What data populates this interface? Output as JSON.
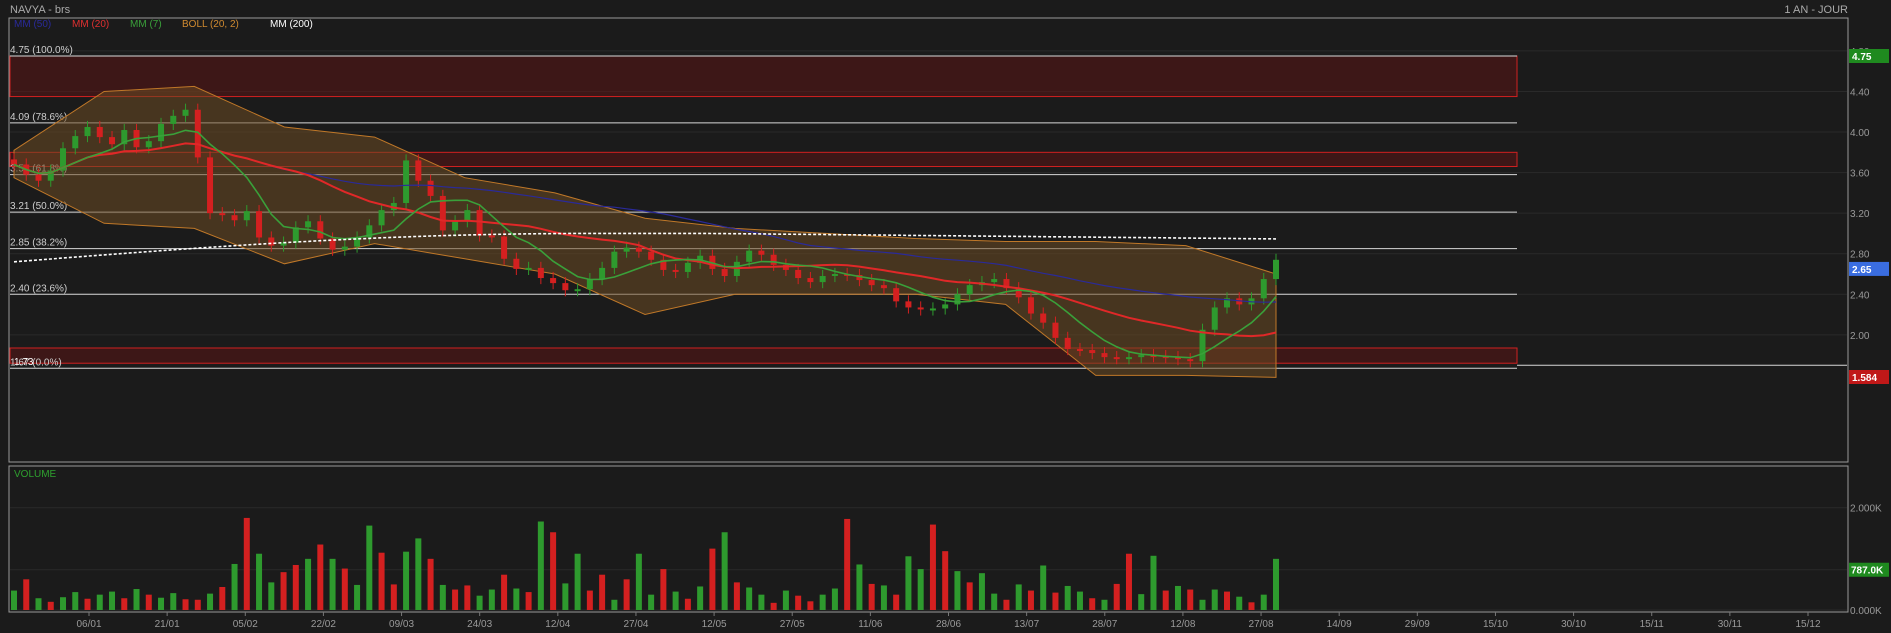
{
  "header": {
    "title": "NAVYA - brs",
    "period": "1 AN - JOUR",
    "legend": [
      {
        "label": "MM (50)",
        "color": "#2a2a9a"
      },
      {
        "label": "MM (20)",
        "color": "#e03030"
      },
      {
        "label": "MM (7)",
        "color": "#3aa03a"
      },
      {
        "label": "BOLL (20, 2)",
        "color": "#d08a30"
      },
      {
        "label": "MM (200)",
        "color": "#ffffff"
      }
    ]
  },
  "colors": {
    "bull": "#2e9a2e",
    "bear": "#d42020",
    "background": "#1b1b1b",
    "grid": "#2a2a2a"
  },
  "chart_data": [
    {
      "type": "candlestick",
      "title": "NAVYA - brs",
      "ylim": [
        1.584,
        4.95
      ],
      "y_ticks": [
        "4.80",
        "4.40",
        "4.00",
        "3.60",
        "3.20",
        "2.80",
        "2.40",
        "2.00"
      ],
      "y_tick_values": [
        4.8,
        4.4,
        4.0,
        3.6,
        3.2,
        2.8,
        2.4,
        2.0
      ],
      "x_ticks": [
        "06/01",
        "21/01",
        "05/02",
        "22/02",
        "09/03",
        "24/03",
        "12/04",
        "27/04",
        "12/05",
        "27/05",
        "11/06",
        "28/06",
        "13/07",
        "28/07",
        "12/08",
        "27/08",
        "14/09",
        "29/09",
        "15/10",
        "30/10",
        "15/11",
        "30/11",
        "15/12"
      ],
      "price_tags": [
        {
          "label": "4.75",
          "value": 4.75,
          "color": "#1f8a1f"
        },
        {
          "label": "2.65",
          "value": 2.65,
          "color": "#3a6de0"
        },
        {
          "label": "1.584",
          "value": 1.584,
          "color": "#c01818"
        }
      ],
      "fib_levels": [
        {
          "label": "4.75  (100.0%)",
          "value": 4.75
        },
        {
          "label": "4.09  (78.6%)",
          "value": 4.09
        },
        {
          "label": "3.58  (61.8%)",
          "value": 3.58
        },
        {
          "label": "3.21  (50.0%)",
          "value": 3.21
        },
        {
          "label": "2.85  (38.2%)",
          "value": 2.85
        },
        {
          "label": "2.40  (23.6%)",
          "value": 2.4
        },
        {
          "label": "1.67  (0.0%)",
          "value": 1.67
        }
      ],
      "zones": [
        {
          "from": 4.35,
          "to": 4.75
        },
        {
          "from": 3.66,
          "to": 3.8
        },
        {
          "from": 1.72,
          "to": 1.87
        }
      ],
      "support_label": {
        "label": "1.73",
        "value": 1.73
      },
      "close_series": [
        3.68,
        3.58,
        3.52,
        3.62,
        3.84,
        3.96,
        4.05,
        3.95,
        3.88,
        4.02,
        3.85,
        3.91,
        4.08,
        4.16,
        4.22,
        3.75,
        3.2,
        3.18,
        3.13,
        3.22,
        2.96,
        2.88,
        2.91,
        3.06,
        3.12,
        2.95,
        2.84,
        2.87,
        2.96,
        3.08,
        3.23,
        3.3,
        3.72,
        3.52,
        3.37,
        3.03,
        3.12,
        3.23,
        2.98,
        2.97,
        2.75,
        2.65,
        2.66,
        2.56,
        2.51,
        2.44,
        2.45,
        2.55,
        2.66,
        2.82,
        2.86,
        2.82,
        2.74,
        2.64,
        2.62,
        2.71,
        2.78,
        2.65,
        2.58,
        2.72,
        2.83,
        2.79,
        2.69,
        2.64,
        2.56,
        2.52,
        2.58,
        2.6,
        2.59,
        2.54,
        2.49,
        2.46,
        2.33,
        2.27,
        2.25,
        2.26,
        2.3,
        2.4,
        2.49,
        2.52,
        2.55,
        2.46,
        2.37,
        2.21,
        2.12,
        1.97,
        1.86,
        1.85,
        1.82,
        1.78,
        1.77,
        1.78,
        1.8,
        1.79,
        1.78,
        1.76,
        1.74,
        2.05,
        2.27,
        2.36,
        2.3,
        2.36,
        2.55,
        2.74
      ],
      "bollinger_upper": [
        3.82,
        4.4,
        4.45,
        4.05,
        3.95,
        3.55,
        3.4,
        3.15,
        3.05,
        3.0,
        2.95,
        2.92,
        2.92,
        2.88,
        2.6
      ],
      "bollinger_lower": [
        3.55,
        3.1,
        3.05,
        2.7,
        2.9,
        2.75,
        2.6,
        2.2,
        2.4,
        2.4,
        2.4,
        2.3,
        1.6,
        1.6,
        1.58
      ],
      "volume": {
        "title": "VOLUME",
        "y_ticks": [
          "2.000K",
          "787.0K",
          "0.000K"
        ],
        "y_tick_values": [
          2000,
          787,
          0
        ],
        "last_tag": "787.0K",
        "values": [
          380,
          600,
          230,
          160,
          250,
          350,
          220,
          300,
          360,
          230,
          410,
          300,
          240,
          330,
          210,
          200,
          320,
          450,
          900,
          1800,
          1100,
          540,
          740,
          880,
          1000,
          1280,
          1000,
          810,
          490,
          1650,
          1120,
          500,
          1140,
          1400,
          1000,
          490,
          400,
          480,
          280,
          400,
          690,
          420,
          350,
          1730,
          1520,
          520,
          1100,
          380,
          690,
          200,
          600,
          1100,
          300,
          800,
          360,
          220,
          460,
          1200,
          1520,
          540,
          440,
          300,
          140,
          380,
          280,
          170,
          300,
          420,
          1780,
          890,
          510,
          480,
          300,
          1050,
          800,
          1670,
          1150,
          760,
          540,
          720,
          320,
          200,
          500,
          380,
          870,
          340,
          470,
          360,
          230,
          200,
          510,
          1100,
          310,
          1060,
          380,
          470,
          400,
          200,
          400,
          360,
          260,
          150,
          300,
          1000
        ],
        "volume_dirs": [
          1,
          0,
          1,
          0,
          1,
          1,
          0,
          1,
          1,
          0,
          1,
          0,
          1,
          1,
          0,
          0,
          1,
          0,
          1,
          0,
          1,
          1,
          0,
          0,
          1,
          0,
          1,
          0,
          1,
          1,
          0,
          0,
          1,
          1,
          0,
          1,
          0,
          0,
          1,
          1,
          0,
          1,
          0,
          1,
          0,
          1,
          1,
          0,
          0,
          1,
          0,
          1,
          1,
          0,
          1,
          0,
          1,
          0,
          1,
          0,
          1,
          1,
          0,
          1,
          0,
          0,
          1,
          1,
          0,
          1,
          0,
          1,
          0,
          1,
          1,
          0,
          0,
          1,
          0,
          1,
          1,
          0,
          1,
          0,
          1,
          0,
          1,
          1,
          0,
          1,
          0,
          0,
          1,
          1,
          0,
          1,
          0,
          1,
          1,
          0,
          1,
          0,
          1,
          1
        ]
      }
    }
  ]
}
